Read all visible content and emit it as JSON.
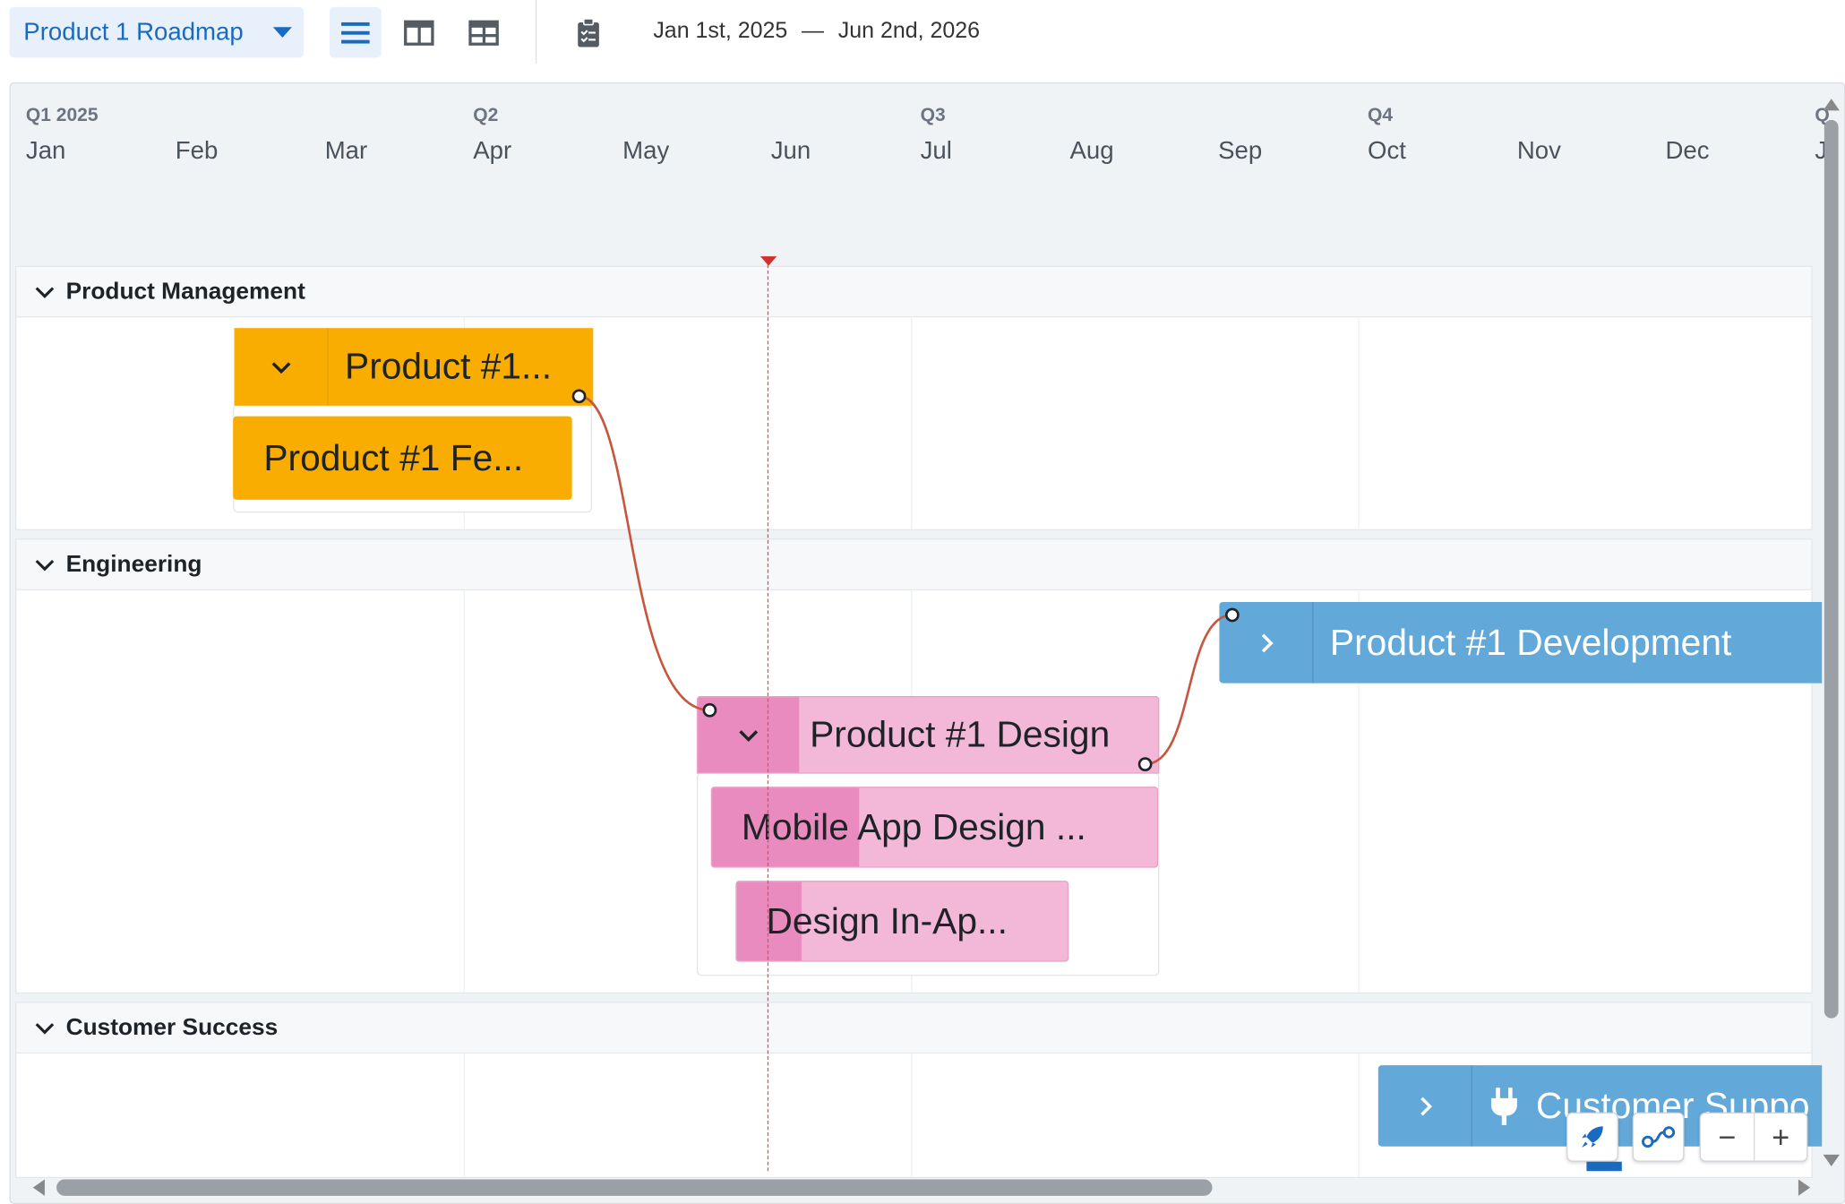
{
  "toolbar": {
    "roadmap_name": "Product 1 Roadmap",
    "start_date": "Jan 1st, 2025",
    "separator": "—",
    "end_date": "Jun 2nd, 2026",
    "icons": [
      "list-view-icon",
      "split-view-icon",
      "table-view-icon",
      "clipboard-icon"
    ]
  },
  "timeline": {
    "quarters": [
      "Q1 2025",
      "Q2",
      "Q3",
      "Q4",
      "Q"
    ],
    "months": [
      "Jan",
      "Feb",
      "Mar",
      "Apr",
      "May",
      "Jun",
      "Jul",
      "Aug",
      "Sep",
      "Oct",
      "Nov",
      "Dec",
      "J"
    ]
  },
  "lanes": [
    {
      "title": "Product Management"
    },
    {
      "title": "Engineering"
    },
    {
      "title": "Customer Success"
    }
  ],
  "items": {
    "pm_group": "Product #1...",
    "pm_feature": "Product #1 Fe...",
    "eng_dev": "Product #1 Development",
    "eng_design": "Product #1 Design",
    "eng_mobile": "Mobile App Design ...",
    "eng_inapp": "Design In-Ap...",
    "cs_support": "Customer Suppo"
  },
  "colors": {
    "accent": "#1a6bbf",
    "orange": "#f9ad00",
    "blue": "#62a8d8",
    "pink_light": "#f3b8d7",
    "pink_dark": "#e98bbf",
    "today": "#d32f2f"
  },
  "controls": {
    "zoom_out": "−",
    "zoom_in": "+"
  }
}
